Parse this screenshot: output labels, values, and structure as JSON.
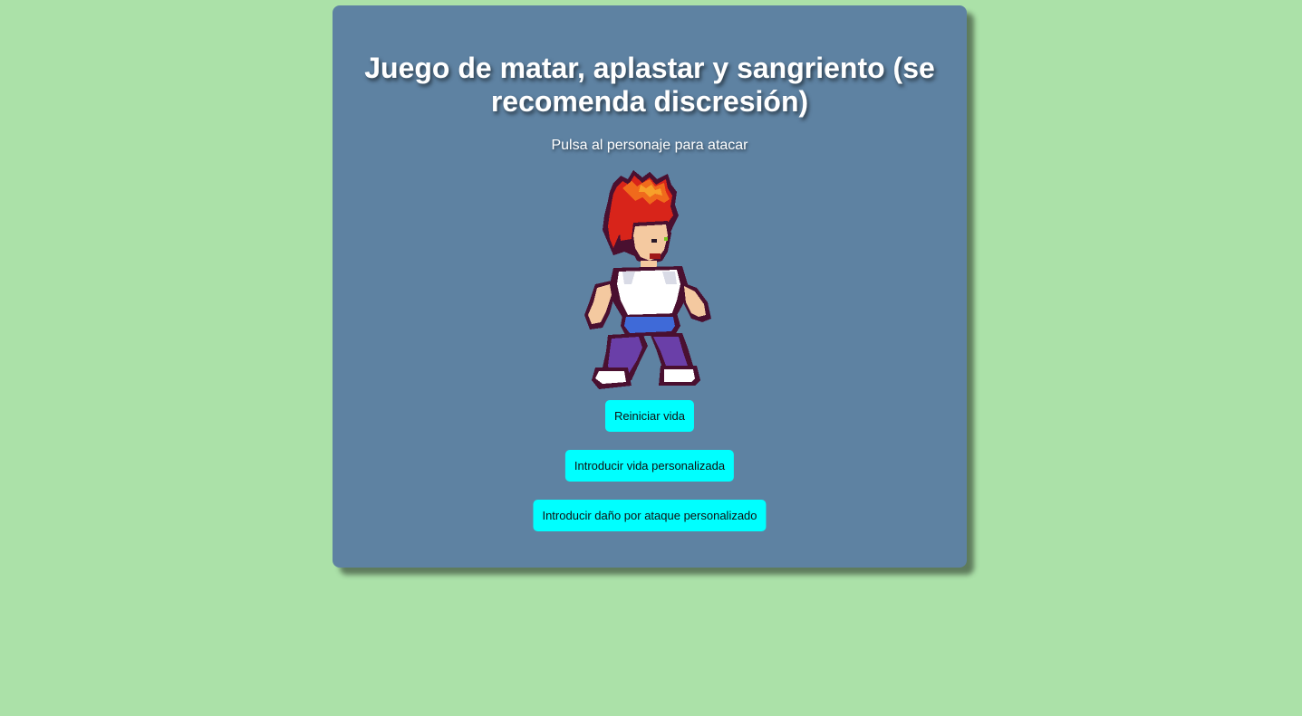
{
  "page": {
    "title": "Juego de matar, aplastar y sangriento (se recomenda discresión)",
    "instruction": "Pulsa al personaje para atacar"
  },
  "character": {
    "name": "pixel-fighter-character",
    "icon": "pixel-art-red-haired-fighter"
  },
  "buttons": {
    "reset_life": "Reiniciar vida",
    "custom_life": "Introducir vida personalizada",
    "custom_damage": "Introducir daño por ataque personalizado"
  },
  "colors": {
    "background": "#abe1a8",
    "card": "#5e82a2",
    "button": "#00ffff"
  }
}
